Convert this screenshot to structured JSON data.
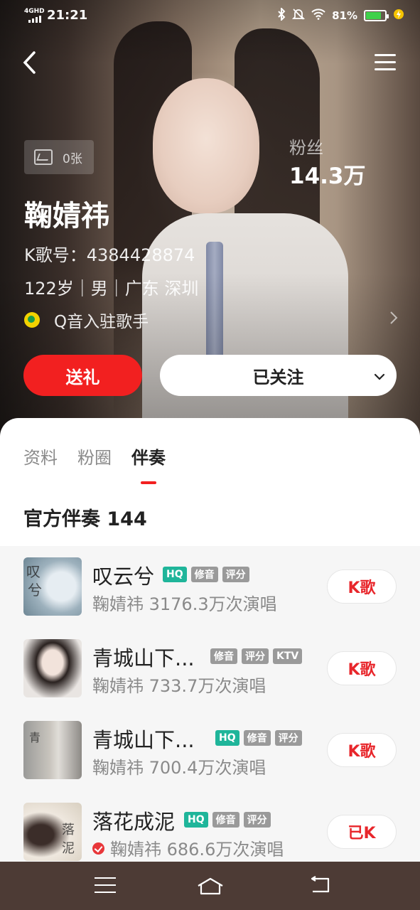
{
  "status_bar": {
    "network": "4GHD",
    "time": "21:21",
    "battery_percent": "81%",
    "battery_level": 0.81,
    "icons": [
      "bluetooth-icon",
      "mute-icon",
      "wifi-icon",
      "battery-icon",
      "charging-icon"
    ]
  },
  "header": {
    "back_icon": "back-icon",
    "menu_icon": "menu-icon"
  },
  "profile": {
    "photo_count": "0张",
    "fans_label": "粉丝",
    "fans_count": "14.3万",
    "name": "鞠婧祎",
    "k_id": "K歌号：4384428874",
    "meta": "122岁｜男｜广东 深圳",
    "q_music": "Q音入驻歌手"
  },
  "actions": {
    "gift_label": "送礼",
    "follow_label": "已关注"
  },
  "tabs": [
    {
      "label": "资料",
      "active": false
    },
    {
      "label": "粉圈",
      "active": false
    },
    {
      "label": "伴奏",
      "active": true
    }
  ],
  "section": {
    "title": "官方伴奏 144"
  },
  "songs": [
    {
      "title": "叹云兮",
      "badges": [
        "HQ",
        "修音",
        "评分"
      ],
      "sub": "鞠婧祎 3176.3万次演唱",
      "button": "K歌",
      "verified": false
    },
    {
      "title": "青城山下...",
      "badges": [
        "修音",
        "评分",
        "KTV"
      ],
      "sub": "鞠婧祎 733.7万次演唱",
      "button": "K歌",
      "verified": false
    },
    {
      "title": "青城山下...",
      "badges": [
        "HQ",
        "修音",
        "评分"
      ],
      "sub": "鞠婧祎 700.4万次演唱",
      "button": "K歌",
      "verified": false
    },
    {
      "title": "落花成泥",
      "badges": [
        "HQ",
        "修音",
        "评分"
      ],
      "sub": "鞠婧祎 686.6万次演唱",
      "button": "已K",
      "verified": true
    }
  ],
  "system_nav": {
    "icons": [
      "recent-apps-icon",
      "home-icon",
      "back-nav-icon"
    ]
  },
  "colors": {
    "accent_red": "#f22020",
    "hq_green": "#1fb59a",
    "nav_bg": "#4d3b35"
  }
}
